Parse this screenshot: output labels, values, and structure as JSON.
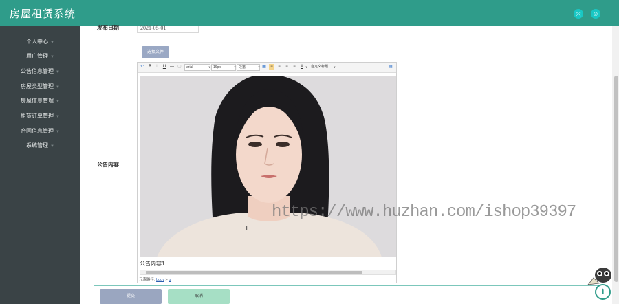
{
  "app": {
    "title": "房屋租赁系统"
  },
  "header": {
    "icons": [
      "fullscreen-icon",
      "user-icon"
    ]
  },
  "sidebar": {
    "items": [
      {
        "label": "个人中心"
      },
      {
        "label": "用户管理"
      },
      {
        "label": "公告信息管理"
      },
      {
        "label": "房屋类型管理"
      },
      {
        "label": "房屋信息管理"
      },
      {
        "label": "租赁订单管理"
      },
      {
        "label": "合同信息管理"
      },
      {
        "label": "系统管理"
      }
    ]
  },
  "form": {
    "date_label": "发布日期",
    "date_value": "2021-05-01",
    "content_label": "公告内容",
    "choose_file_label": "选择文件",
    "editor": {
      "toolbar": {
        "font_family": "arial",
        "font_size": "16px",
        "paragraph": "段落",
        "custom_title": "自定义标题"
      },
      "content_text": "公告内容1",
      "element_path_label": "元素路径:",
      "element_path": [
        "body",
        "p"
      ]
    },
    "submit_label": "提交",
    "cancel_label": "取消"
  },
  "watermark": "https://www.huzhan.com/ishop39397",
  "colors": {
    "header": "#2f9c8a",
    "sidebar": "#3a4346",
    "accent": "#19c7c4"
  }
}
